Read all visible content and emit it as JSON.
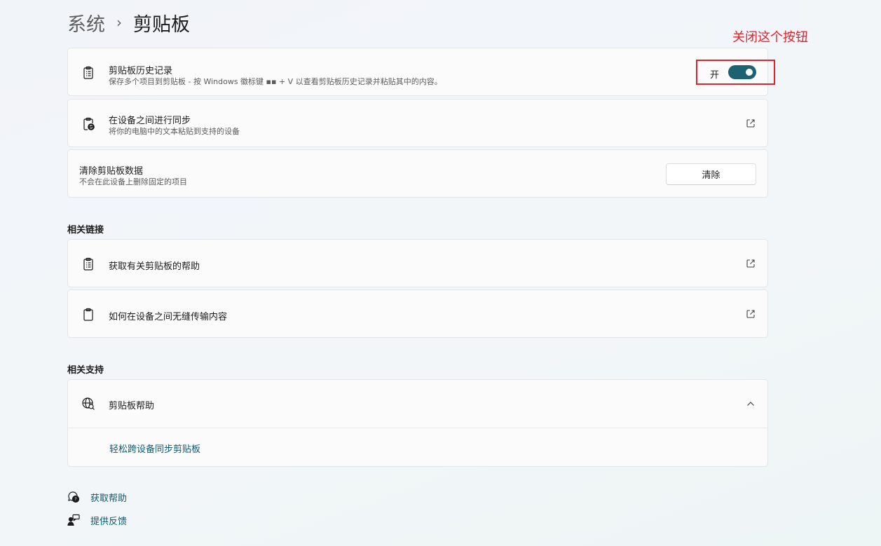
{
  "breadcrumb": {
    "parent": "系统",
    "separator": "›",
    "current": "剪贴板"
  },
  "annotation": {
    "text": "关闭这个按钮",
    "color": "#e8202a"
  },
  "settings": {
    "history": {
      "title": "剪贴板历史记录",
      "description": "保存多个项目到剪贴板 - 按 Windows 徽标键 ▪▪ + V 以查看剪贴板历史记录并粘贴其中的内容。",
      "toggle_label": "开",
      "toggle_on": true,
      "icon": "clipboard-list-icon"
    },
    "sync": {
      "title": "在设备之间进行同步",
      "description": "将你的电脑中的文本粘贴到支持的设备",
      "icon": "clipboard-sync-icon"
    },
    "clear": {
      "title": "清除剪贴板数据",
      "description": "不会在此设备上删除固定的项目",
      "button_label": "清除"
    }
  },
  "related_links": {
    "heading": "相关链接",
    "items": [
      {
        "label": "获取有关剪贴板的帮助",
        "icon": "clipboard-list-icon"
      },
      {
        "label": "如何在设备之间无缝传输内容",
        "icon": "clipboard-icon"
      }
    ]
  },
  "related_support": {
    "heading": "相关支持",
    "title": "剪贴板帮助",
    "icon": "globe-search-icon",
    "expanded": true,
    "links": [
      "轻松跨设备同步剪贴板"
    ]
  },
  "footer": {
    "get_help": "获取帮助",
    "feedback": "提供反馈"
  },
  "colors": {
    "accent": "#1d6272",
    "link": "#0f5a6b",
    "annotation": "#e8202a"
  }
}
